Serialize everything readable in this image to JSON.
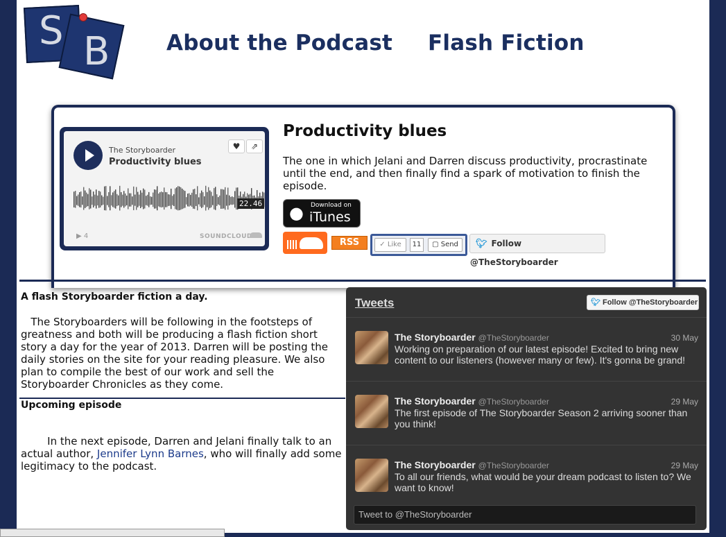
{
  "nav": {
    "about": "About the Podcast",
    "flash": "Flash Fiction"
  },
  "logo": {
    "letter1": "S",
    "letter2": "B"
  },
  "episode": {
    "title": "Productivity blues",
    "description": "The one in which Jelani and Darren discuss productivity, procrastinate until the end, and then finally find a spark of motivation to finish the episode."
  },
  "soundcloud": {
    "user": "The Storyboarder",
    "track": "Productivity blues",
    "duration": "22.46",
    "plays": "4",
    "brand": "SOUNDCLOUD"
  },
  "itunes": {
    "small": "Download on",
    "large": "iTunes"
  },
  "social": {
    "rss": "RSS",
    "like": "Like",
    "like_count": "11",
    "send": "Send",
    "follow": "Follow @TheStoryboarder"
  },
  "flash": {
    "title": "A flash Storyboarder fiction a day.",
    "text": "The Storyboarders will be following in the footsteps of greatness and both will be producing a flash fiction short story a day for the year of 2013. Darren will be posting the daily stories on the site for your reading pleasure. We also plan to compile the best of our work and sell the Storyboarder Chronicles as they come."
  },
  "upcoming": {
    "title": "Upcoming episode",
    "text_before": "In the next episode, Darren and Jelani finally talk to an actual author, ",
    "link": "Jennifer Lynn Barnes",
    "text_after": ", who will finally add some legitimacy to the podcast."
  },
  "tweets": {
    "header": "Tweets",
    "follow": "Follow @TheStoryboarder",
    "items": [
      {
        "name": "The Storyboarder",
        "handle": "@TheStoryboarder",
        "date": "30 May",
        "text": "Working on preparation of our latest episode! Excited to bring new content to our listeners (however many or few). It's gonna be grand!"
      },
      {
        "name": "The Storyboarder",
        "handle": "@TheStoryboarder",
        "date": "29 May",
        "text": "The first episode of The Storyboarder Season 2 arriving sooner than you think!"
      },
      {
        "name": "The Storyboarder",
        "handle": "@TheStoryboarder",
        "date": "29 May",
        "text": "To all our friends, what would be your dream podcast to listen to? We want to know!"
      }
    ],
    "compose": "Tweet to @TheStoryboarder"
  },
  "colors": {
    "navy": "#1b2a55",
    "nav_text": "#1b2f60",
    "soundcloud_orange": "#ff6a1e",
    "rss_orange": "#f47f1f",
    "twitter_blue": "#2b9bd8"
  }
}
